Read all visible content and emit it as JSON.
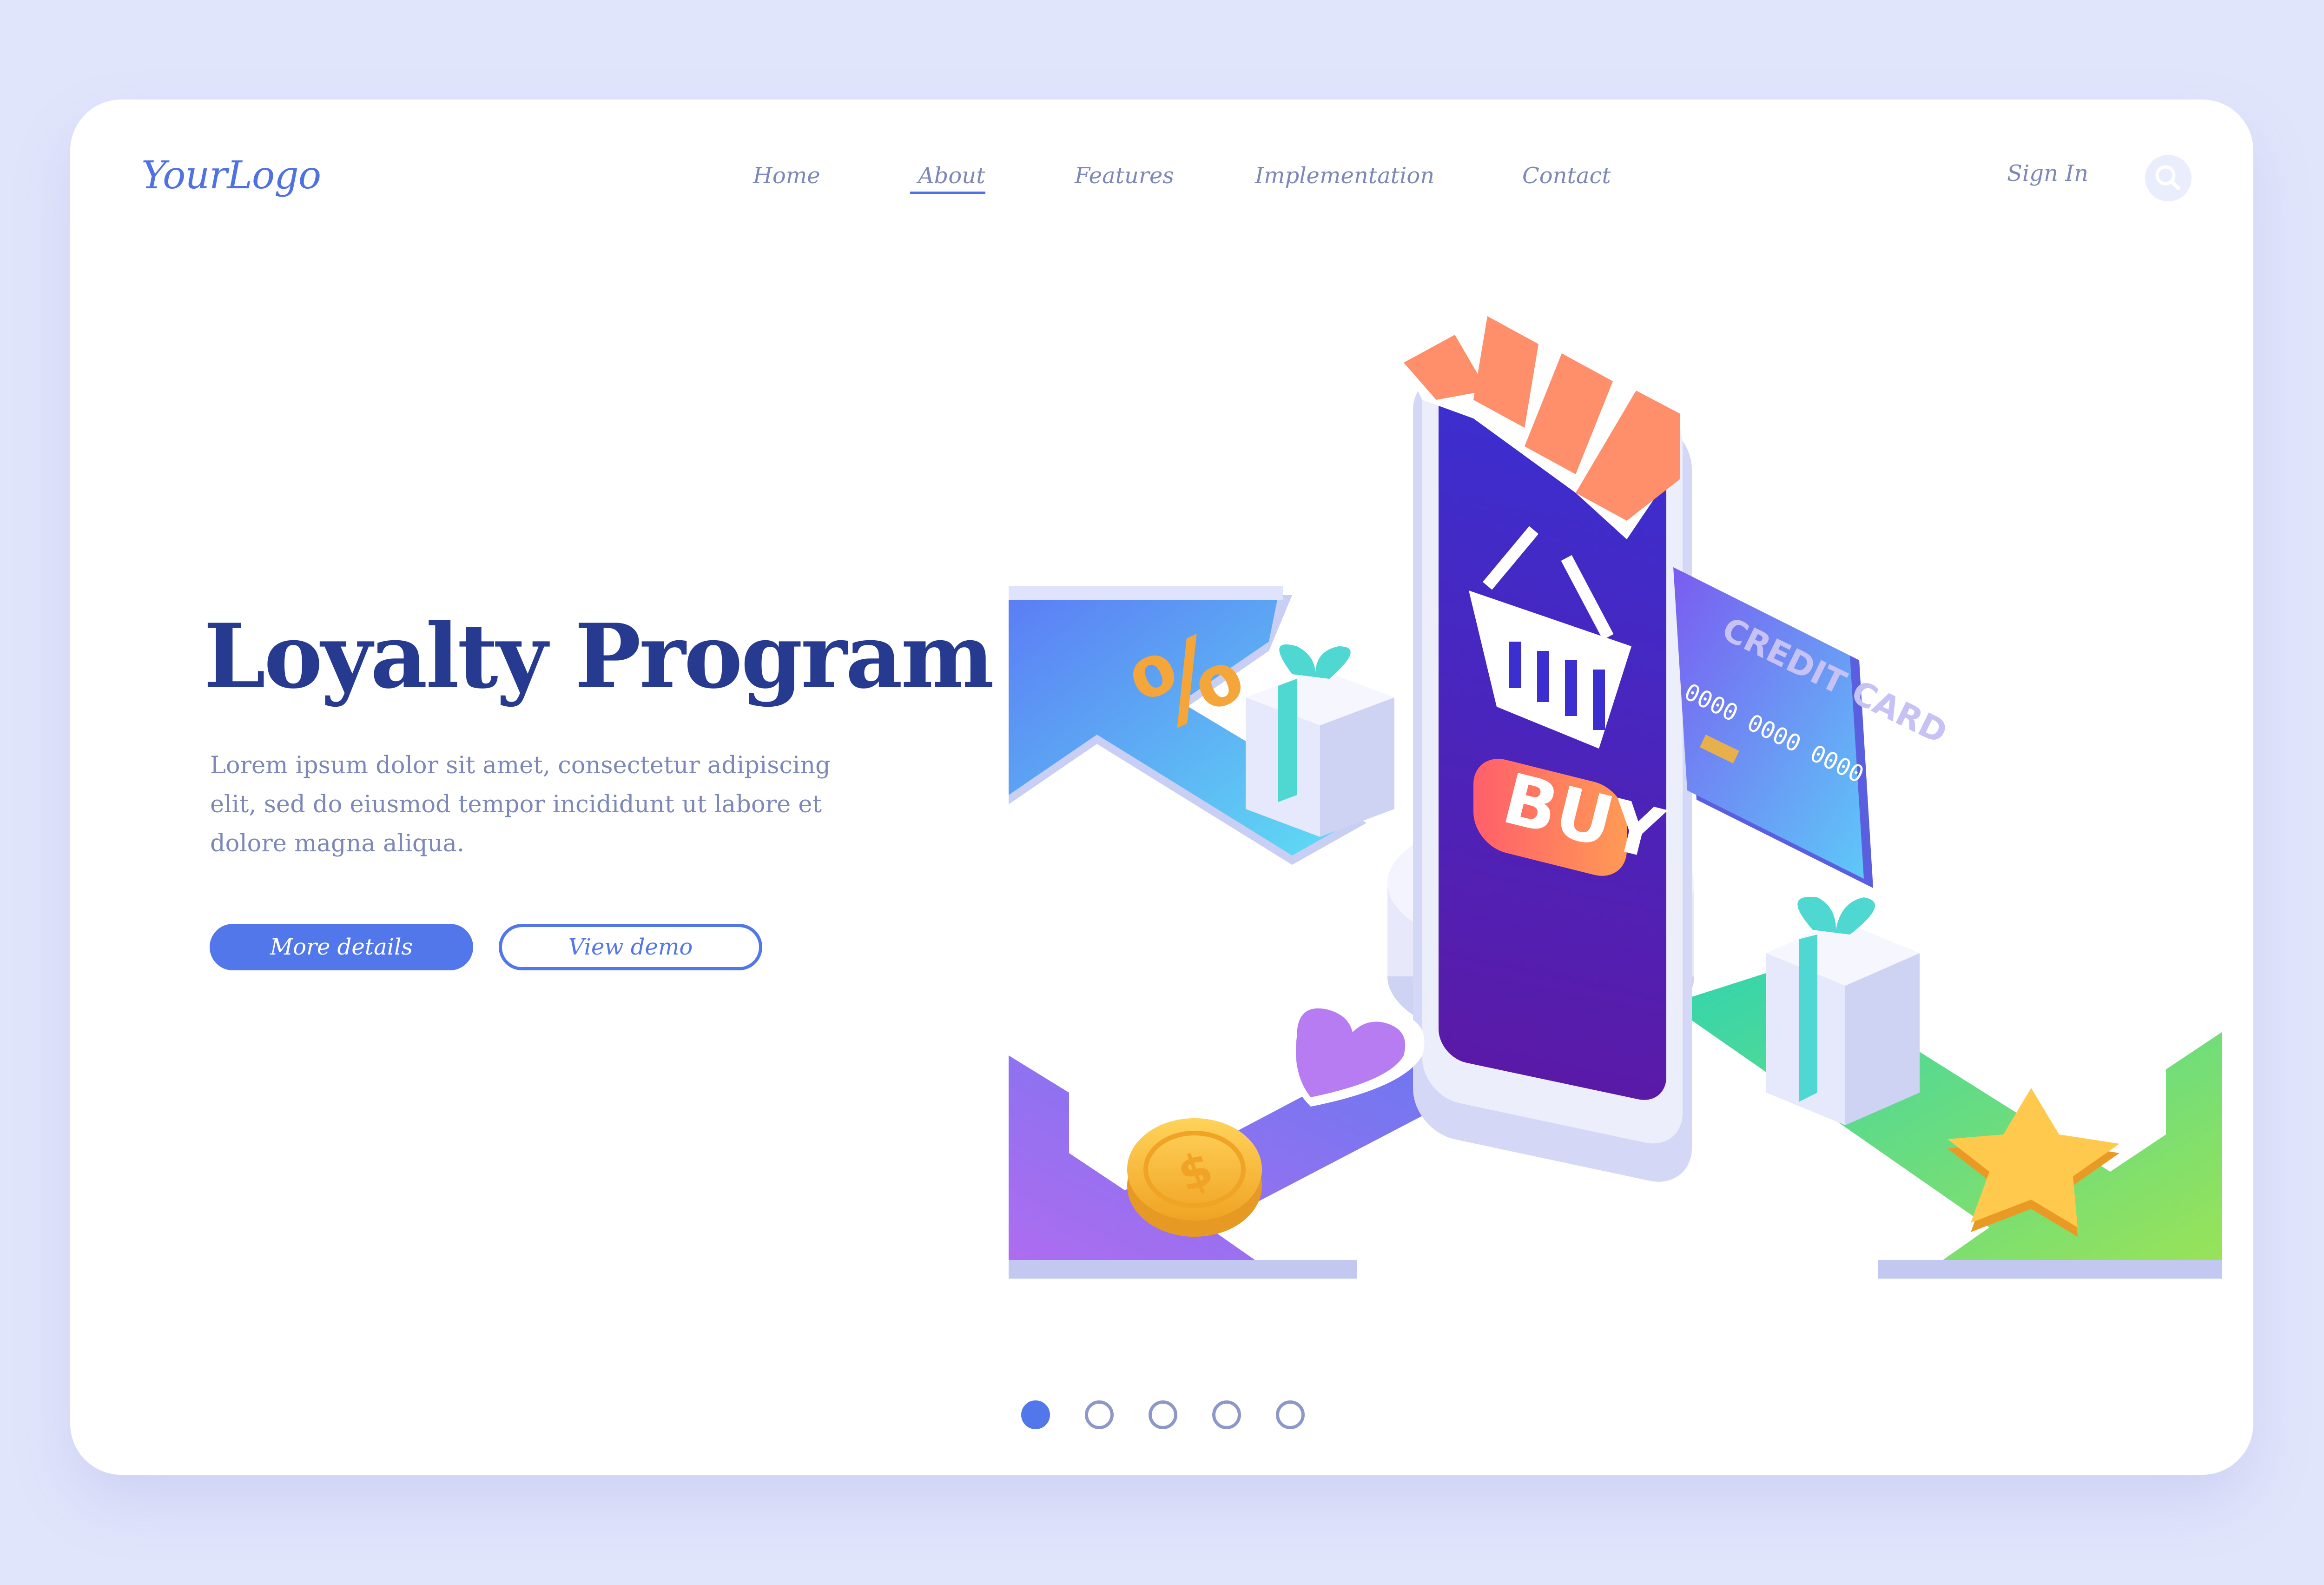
{
  "header": {
    "logo": "YourLogo",
    "nav": [
      {
        "label": "Home"
      },
      {
        "label": "About"
      },
      {
        "label": "Features"
      },
      {
        "label": "Implementation"
      },
      {
        "label": "Contact"
      }
    ],
    "active_nav": "About",
    "sign_in": "Sign In",
    "search_icon": "search-icon"
  },
  "hero": {
    "title": "Loyalty Program",
    "text": "Lorem ipsum dolor sit amet, consectetur adipiscing elit, sed do eiusmod tempor incididunt ut labore et dolore magna aliqua.",
    "primary_button": "More details",
    "secondary_button": "View demo"
  },
  "illustration": {
    "buy_label": "BUY",
    "card_label": "CREDIT CARD",
    "card_number": "0000 0000 0000",
    "percent_symbol": "%",
    "coin_symbol": "$"
  },
  "pagination": {
    "count": 5,
    "active": 1
  },
  "colors": {
    "accent": "#5177ea",
    "title": "#263a8f",
    "text": "#7d88b8",
    "background": "#e1e5fb"
  }
}
